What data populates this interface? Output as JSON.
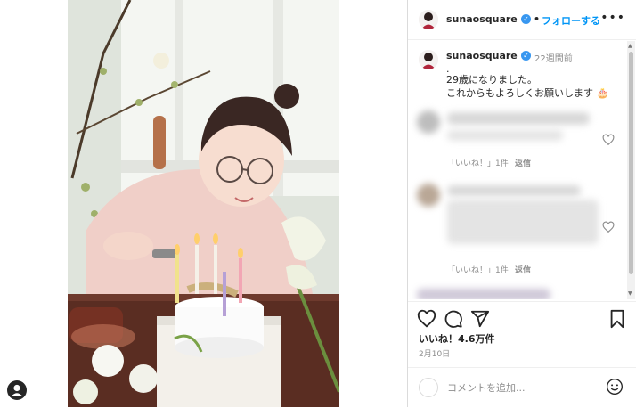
{
  "post": {
    "username": "sunaosquare",
    "follow_label": "フォローする",
    "follow_separator": "•",
    "more_label": "•••",
    "verified_mark": "✓"
  },
  "caption": {
    "username": "sunaosquare",
    "time_ago": "22週間前",
    "line1": ".",
    "line2": "29歳になりました。",
    "line3": "これからもよろしくお願いします 🎂"
  },
  "comments": [
    {
      "like_label": "「いいね！」1件",
      "reply_label": "返信"
    },
    {
      "like_label": "「いいね！」1件",
      "reply_label": "返信"
    }
  ],
  "footer": {
    "likes": "いいね！4.6万件",
    "date": "2月10日",
    "comment_placeholder": "コメントを追加..."
  },
  "icons": {
    "like": "heart-icon",
    "comment": "comment-icon",
    "share": "send-icon",
    "save": "bookmark-icon",
    "emoji": "emoji-icon",
    "user": "user-icon"
  },
  "colors": {
    "accent": "#0095f6",
    "verified": "#3897f0",
    "text": "#262626",
    "muted": "#8e8e8e"
  }
}
